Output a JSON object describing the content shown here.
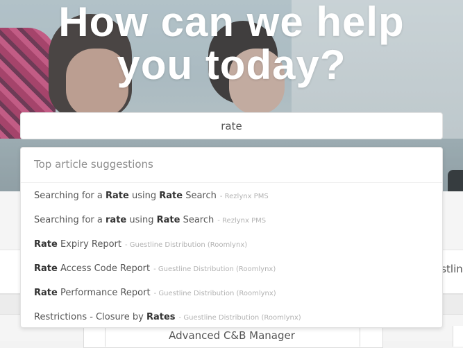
{
  "hero": {
    "title_line1": "How can we help",
    "title_line2": "you today?"
  },
  "search": {
    "value": "rate"
  },
  "suggestions": {
    "header": "Top article suggestions",
    "items": [
      {
        "parts": [
          [
            "Searching for a ",
            false
          ],
          [
            "Rate",
            true
          ],
          [
            " using ",
            false
          ],
          [
            "Rate",
            true
          ],
          [
            " Search",
            false
          ]
        ],
        "source": "- Rezlynx PMS"
      },
      {
        "parts": [
          [
            "Searching for a ",
            false
          ],
          [
            "rate",
            true
          ],
          [
            " using ",
            false
          ],
          [
            "Rate",
            true
          ],
          [
            " Search",
            false
          ]
        ],
        "source": "- Rezlynx PMS"
      },
      {
        "parts": [
          [
            "Rate",
            true
          ],
          [
            " Expiry Report",
            false
          ]
        ],
        "source": "- Guestline Distribution (Roomlynx)"
      },
      {
        "parts": [
          [
            "Rate",
            true
          ],
          [
            " Access Code Report",
            false
          ]
        ],
        "source": "- Guestline Distribution (Roomlynx)"
      },
      {
        "parts": [
          [
            "Rate",
            true
          ],
          [
            " Performance Report",
            false
          ]
        ],
        "source": "- Guestline Distribution (Roomlynx)"
      },
      {
        "parts": [
          [
            "Restrictions - Closure by ",
            false
          ],
          [
            "Rates",
            true
          ]
        ],
        "source": "- Guestline Distribution (Roomlynx)"
      }
    ]
  },
  "background": {
    "right_card_text": "estlin",
    "bottom_card_label": "Advanced C&B Manager"
  }
}
